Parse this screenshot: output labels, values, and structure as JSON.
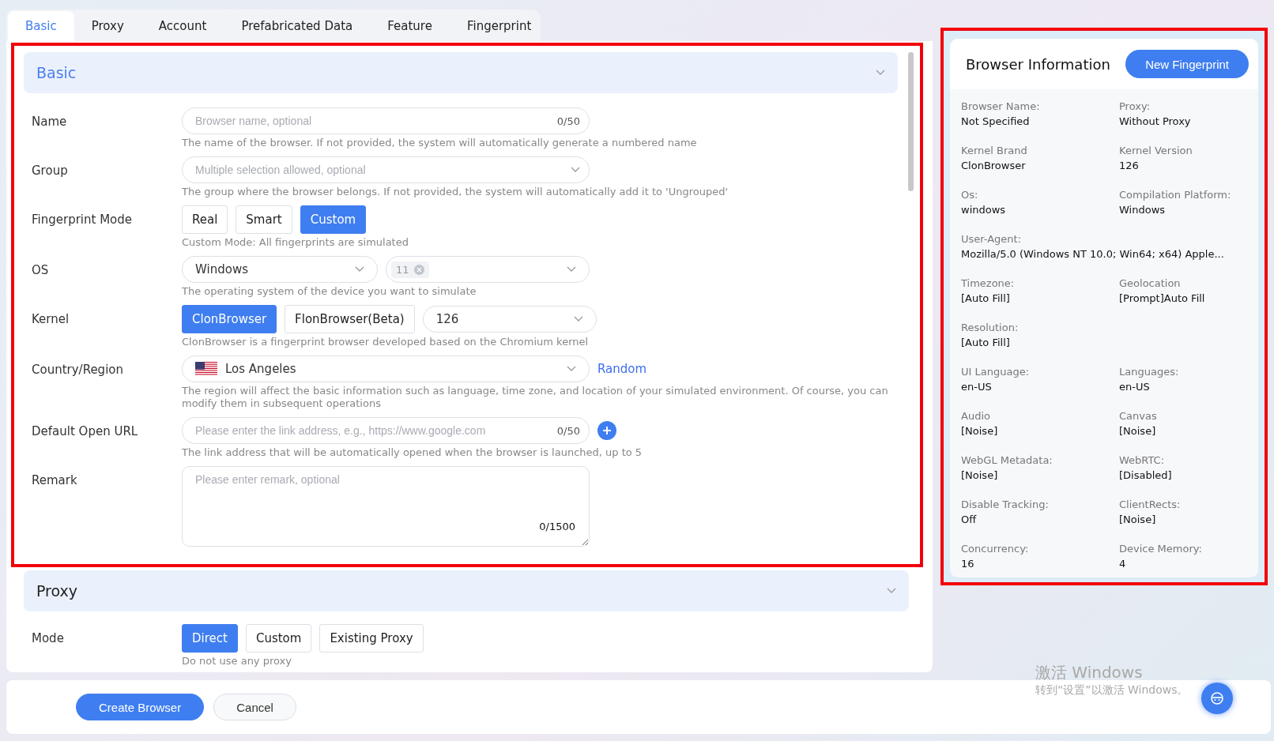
{
  "tabs": [
    {
      "label": "Basic",
      "selected": true
    },
    {
      "label": "Proxy",
      "selected": false
    },
    {
      "label": "Account",
      "selected": false
    },
    {
      "label": "Prefabricated Data",
      "selected": false
    },
    {
      "label": "Feature",
      "selected": false
    },
    {
      "label": "Fingerprint",
      "selected": false
    }
  ],
  "basic_section": {
    "title": "Basic",
    "fields": [
      {
        "label": "Name",
        "kind": "input",
        "placeholder": "Browser name, optional",
        "counter": "0/50",
        "hint": "The name of the browser. If not provided, the system will automatically generate a numbered name"
      },
      {
        "label": "Group",
        "kind": "select",
        "placeholder": "Multiple selection allowed, optional",
        "hint": "The group where the browser belongs. If not provided, the system will automatically add it to 'Ungrouped'"
      },
      {
        "label": "Fingerprint Mode",
        "kind": "choice",
        "options": [
          {
            "label": "Real",
            "selected": false
          },
          {
            "label": "Smart",
            "selected": false
          },
          {
            "label": "Custom",
            "selected": true
          }
        ],
        "hint": "Custom Mode: All fingerprints are simulated"
      },
      {
        "label": "OS",
        "kind": "os",
        "value": "Windows",
        "tag": "11",
        "hint": "The operating system of the device you want to simulate"
      },
      {
        "label": "Kernel",
        "kind": "choice",
        "options": [
          {
            "label": "ClonBrowser",
            "selected": true
          },
          {
            "label": "FlonBrowser(Beta)",
            "selected": false
          }
        ],
        "select_value": "126",
        "hint": "ClonBrowser is a fingerprint browser developed based on the Chromium kernel"
      },
      {
        "label": "Country/Region",
        "kind": "country",
        "value": "Los Angeles",
        "link": "Random",
        "hint": "The region will affect the basic information such as language, time zone, and location of your simulated environment. Of course, you can modify them in subsequent operations"
      },
      {
        "label": "Default Open URL",
        "kind": "url",
        "placeholder": "Please enter the link address, e.g., https://www.google.com",
        "counter": "0/50",
        "hint": "The link address that will be automatically opened when the browser is launched, up to 5"
      },
      {
        "label": "Remark",
        "kind": "textarea",
        "placeholder": "Please enter remark, optional",
        "counter": "0/1500"
      }
    ]
  },
  "proxy_section": {
    "title": "Proxy",
    "fields": [
      {
        "label": "Mode",
        "kind": "choice",
        "options": [
          {
            "label": "Direct",
            "selected": true
          },
          {
            "label": "Custom",
            "selected": false
          },
          {
            "label": "Existing Proxy",
            "selected": false
          }
        ],
        "hint": "Do not use any proxy"
      }
    ]
  },
  "info_panel": {
    "title": "Browser Information",
    "button": "New Fingerprint",
    "rows": [
      [
        {
          "label": "Browser Name:",
          "value": "Not Specified"
        },
        {
          "label": "Proxy:",
          "value": "Without Proxy"
        }
      ],
      [
        {
          "label": "Kernel Brand",
          "value": "ClonBrowser"
        },
        {
          "label": "Kernel Version",
          "value": "126"
        }
      ],
      [
        {
          "label": "Os:",
          "value": "windows"
        },
        {
          "label": "Compilation Platform:",
          "value": "Windows"
        }
      ],
      [
        {
          "label": "User-Agent:",
          "value": "Mozilla/5.0 (Windows NT 10.0; Win64; x64) Apple..."
        }
      ],
      [
        {
          "label": "Timezone:",
          "value": "[Auto Fill]"
        },
        {
          "label": "Geolocation",
          "value": "[Prompt]Auto Fill"
        }
      ],
      [
        {
          "label": "Resolution:",
          "value": "[Auto Fill]"
        }
      ],
      [
        {
          "label": "UI Language:",
          "value": "en-US"
        },
        {
          "label": "Languages:",
          "value": "en-US"
        }
      ],
      [
        {
          "label": "Audio",
          "value": "[Noise]"
        },
        {
          "label": "Canvas",
          "value": "[Noise]"
        }
      ],
      [
        {
          "label": "WebGL Metadata:",
          "value": "[Noise]"
        },
        {
          "label": "WebRTC:",
          "value": "[Disabled]"
        }
      ],
      [
        {
          "label": "Disable Tracking:",
          "value": "Off"
        },
        {
          "label": "ClientRects:",
          "value": "[Noise]"
        }
      ],
      [
        {
          "label": "Concurrency:",
          "value": "16"
        },
        {
          "label": "Device Memory:",
          "value": "4"
        }
      ]
    ]
  },
  "footer": {
    "buttons": [
      {
        "label": "Create Browser",
        "kind": "primary"
      },
      {
        "label": "Cancel",
        "kind": "default"
      }
    ]
  },
  "os_watermark": {
    "title": "激活 Windows",
    "subtitle": "转到“设置”以激活 Windows。"
  }
}
